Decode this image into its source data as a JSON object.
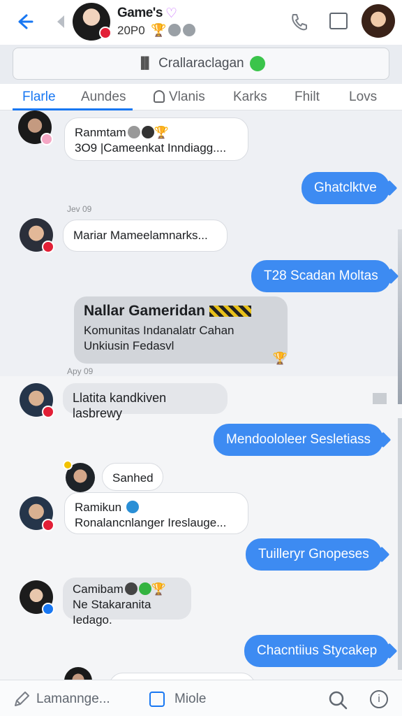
{
  "header": {
    "group_name": "Game's",
    "heart": "♡",
    "subtitle": "20P0",
    "trophy": "🏆"
  },
  "pinned": {
    "icon": "bar-chart-icon",
    "text": "Crallaraclagan"
  },
  "tabs": [
    {
      "label": "Flarle",
      "active": true
    },
    {
      "label": "Aundes",
      "active": false
    },
    {
      "label": "Vlanis",
      "active": false
    },
    {
      "label": "Karks",
      "active": false
    },
    {
      "label": "Fhilt",
      "active": false
    },
    {
      "label": "Lovs",
      "active": false
    }
  ],
  "messages": {
    "m1": {
      "sender": "Ranmtam",
      "text": "3O9 |Cameenkat Inndiagg....",
      "icons": "🏆"
    },
    "m2": {
      "text": "Ghatclktve"
    },
    "date1": "Jev 09",
    "m3": {
      "text": "Mariar Mameelamnarks..."
    },
    "m4": {
      "text": "T28 Scadan Moltas"
    },
    "m5": {
      "title": "Nallar Gameridan",
      "line1": "Komunitas Indanalatr Cahan",
      "line2": "Unkiusin Fedasvl",
      "reaction": "🏆"
    },
    "date2": "Apy 09",
    "m6": {
      "text": "Llatita kandkiven lasbrewy"
    },
    "m7": {
      "text": "Mendoololeer Sesletiass"
    },
    "m8": {
      "text": "Sanhed"
    },
    "m9": {
      "sender": "Ramikun",
      "text": "Ronalancnlanger Ireslauge..."
    },
    "m10": {
      "text": "Tuilleryr Gnopeses"
    },
    "m11": {
      "sender": "Camibam",
      "text": "Ne Stakaranita Iedago.",
      "icons": "🏆"
    },
    "m12": {
      "text": "Chacntiius Stycakep"
    }
  },
  "composer": {
    "placeholder": "Lamannge...",
    "mode": "Miole"
  },
  "colors": {
    "accent": "#1877f2",
    "outgoing_bubble": "#3d8bf2",
    "status_red": "#e21f36"
  }
}
